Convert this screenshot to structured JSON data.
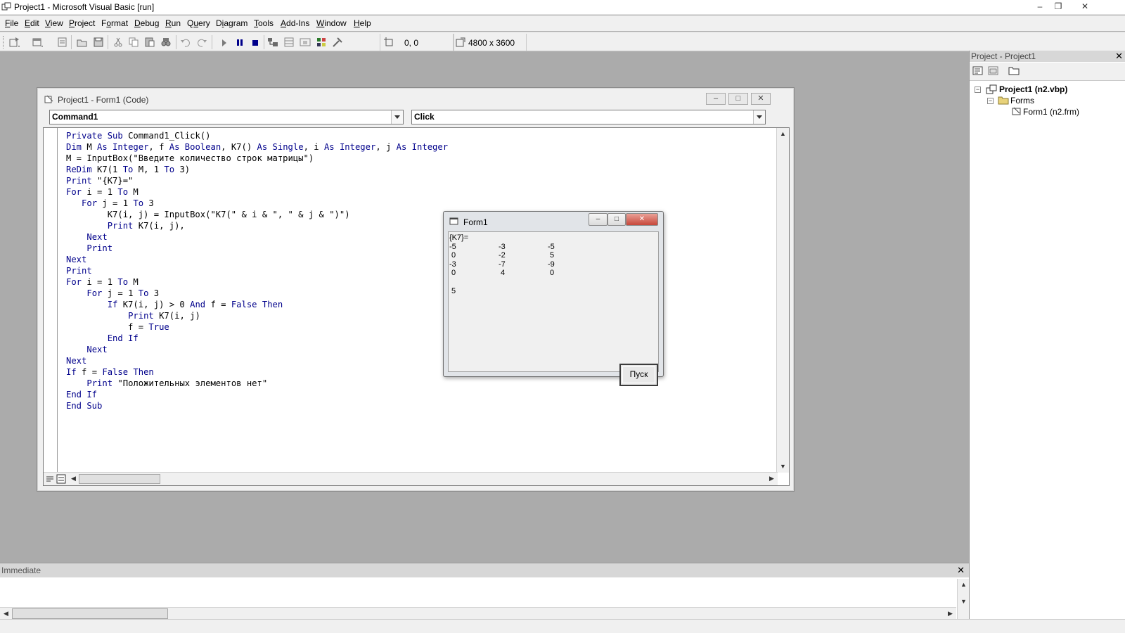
{
  "window": {
    "title": "Project1 - Microsoft Visual Basic [run]"
  },
  "menu": [
    {
      "key": "F",
      "rest": "ile"
    },
    {
      "key": "E",
      "rest": "dit"
    },
    {
      "key": "V",
      "rest": "iew"
    },
    {
      "key": "P",
      "rest": "roject"
    },
    {
      "pre": "F",
      "key": "o",
      "rest": "rmat"
    },
    {
      "key": "D",
      "rest": "ebug"
    },
    {
      "key": "R",
      "rest": "un"
    },
    {
      "pre": "Q",
      "key": "u",
      "rest": "ery"
    },
    {
      "pre": "D",
      "key": "i",
      "rest": "agram"
    },
    {
      "key": "T",
      "rest": "ools"
    },
    {
      "key": "A",
      "rest": "dd-Ins"
    },
    {
      "key": "W",
      "rest": "indow"
    },
    {
      "key": "H",
      "rest": "elp"
    }
  ],
  "toolbar": {
    "position": "0, 0",
    "size": "4800 x 3600"
  },
  "code_window": {
    "title": "Project1 - Form1 (Code)",
    "object_combo": "Command1",
    "proc_combo": "Click",
    "lines": [
      [
        [
          "kw",
          "Private Sub "
        ],
        [
          "",
          "Command1_Click()"
        ]
      ],
      [
        [
          "kw",
          "Dim "
        ],
        [
          "",
          "M "
        ],
        [
          "kw",
          "As Integer"
        ],
        [
          "",
          ", f "
        ],
        [
          "kw",
          "As Boolean"
        ],
        [
          "",
          ", K7() "
        ],
        [
          "kw",
          "As Single"
        ],
        [
          "",
          ", i "
        ],
        [
          "kw",
          "As Integer"
        ],
        [
          "",
          ", j "
        ],
        [
          "kw",
          "As Integer"
        ]
      ],
      [
        [
          "",
          "M = InputBox(\"Введите количество строк матрицы\")"
        ]
      ],
      [
        [
          "kw",
          "ReDim "
        ],
        [
          "",
          "K7(1 "
        ],
        [
          "kw",
          "To "
        ],
        [
          "",
          "M, 1 "
        ],
        [
          "kw",
          "To "
        ],
        [
          "",
          "3)"
        ]
      ],
      [
        [
          "kw",
          "Print "
        ],
        [
          "",
          "\"{K7}=\""
        ]
      ],
      [
        [
          "kw",
          "For "
        ],
        [
          "",
          "i = 1 "
        ],
        [
          "kw",
          "To "
        ],
        [
          "",
          "M"
        ]
      ],
      [
        [
          "",
          "   "
        ],
        [
          "kw",
          "For "
        ],
        [
          "",
          "j = 1 "
        ],
        [
          "kw",
          "To "
        ],
        [
          "",
          "3"
        ]
      ],
      [
        [
          "",
          "        K7(i, j) = InputBox(\"K7(\" & i & \", \" & j & \")\")"
        ]
      ],
      [
        [
          "",
          "        "
        ],
        [
          "kw",
          "Print "
        ],
        [
          "",
          "K7(i, j),"
        ]
      ],
      [
        [
          "",
          "    "
        ],
        [
          "kw",
          "Next"
        ]
      ],
      [
        [
          "",
          "    "
        ],
        [
          "kw",
          "Print"
        ]
      ],
      [
        [
          "kw",
          "Next"
        ]
      ],
      [
        [
          "kw",
          "Print"
        ]
      ],
      [
        [
          "kw",
          "For "
        ],
        [
          "",
          "i = 1 "
        ],
        [
          "kw",
          "To "
        ],
        [
          "",
          "M"
        ]
      ],
      [
        [
          "",
          "    "
        ],
        [
          "kw",
          "For "
        ],
        [
          "",
          "j = 1 "
        ],
        [
          "kw",
          "To "
        ],
        [
          "",
          "3"
        ]
      ],
      [
        [
          "",
          "        "
        ],
        [
          "kw",
          "If "
        ],
        [
          "",
          "K7(i, j) > 0 "
        ],
        [
          "kw",
          "And "
        ],
        [
          "",
          "f = "
        ],
        [
          "kw",
          "False Then"
        ]
      ],
      [
        [
          "",
          "            "
        ],
        [
          "kw",
          "Print "
        ],
        [
          "",
          "K7(i, j)"
        ]
      ],
      [
        [
          "",
          "            f = "
        ],
        [
          "kw",
          "True"
        ]
      ],
      [
        [
          "",
          "        "
        ],
        [
          "kw",
          "End If"
        ]
      ],
      [
        [
          "",
          "    "
        ],
        [
          "kw",
          "Next"
        ]
      ],
      [
        [
          "kw",
          "Next"
        ]
      ],
      [
        [
          "kw",
          "If "
        ],
        [
          "",
          "f = "
        ],
        [
          "kw",
          "False Then"
        ]
      ],
      [
        [
          "",
          "    "
        ],
        [
          "kw",
          "Print "
        ],
        [
          "",
          "\"Положительных элементов нет\""
        ]
      ],
      [
        [
          "kw",
          "End If"
        ]
      ],
      [
        [
          "kw",
          "End Sub"
        ]
      ]
    ]
  },
  "form1": {
    "title": "Form1",
    "header": "{K7}=",
    "rows": [
      [
        "-5",
        "-3",
        "-5"
      ],
      [
        "0",
        "-2",
        "5"
      ],
      [
        "-3",
        "-7",
        "-9"
      ],
      [
        "0",
        "4",
        "0"
      ]
    ],
    "result": "5",
    "button": "Пуск"
  },
  "project_pane": {
    "title": "Project - Project1",
    "project_node": "Project1 (n2.vbp)",
    "forms_node": "Forms",
    "form_node": "Form1 (n2.frm)"
  },
  "immediate": {
    "title": "Immediate"
  }
}
